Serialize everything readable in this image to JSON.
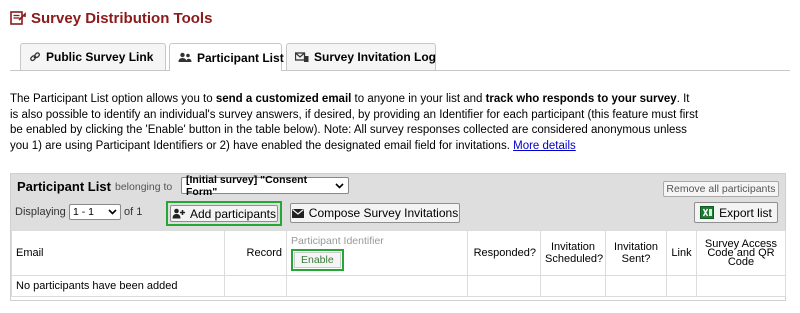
{
  "header": {
    "title": "Survey Distribution Tools",
    "icon": "survey-distribution-icon",
    "color": "#8b1a1a"
  },
  "tabs": [
    {
      "label": "Public Survey Link",
      "icon": "link-icon",
      "active": false
    },
    {
      "label": "Participant List",
      "icon": "users-icon",
      "active": true
    },
    {
      "label": "Survey Invitation Log",
      "icon": "mail-log-icon",
      "active": false
    }
  ],
  "intro": {
    "p1": "The Participant List option allows you to ",
    "b1": "send a customized email",
    "p2": " to anyone in your list and ",
    "b2": "track who responds to your survey",
    "p3": ". It is also possible to identify an individual's survey answers, if desired, by providing an Identifier for each participant (this feature must first be enabled by clicking the 'Enable' button in the table below). Note: All survey responses collected are considered anonymous unless you 1) are using Participant Identifiers or 2) have enabled the designated email field for invitations. ",
    "link": "More details"
  },
  "panel": {
    "title": "Participant List",
    "belonging": "belonging to",
    "instrument_selected": "[Initial survey] \"Consent Form\"",
    "remove_all": "Remove all participants",
    "displaying": "Displaying",
    "page_selected": "1 - 1",
    "of": "of 1",
    "add_participants": "Add participants",
    "compose": "Compose Survey Invitations",
    "export": "Export list"
  },
  "table": {
    "columns": {
      "email": "Email",
      "record": "Record",
      "participant_identifier": "Participant Identifier",
      "enable": "Enable",
      "responded": "Responded?",
      "invitation_scheduled": "Invitation Scheduled?",
      "invitation_sent": "Invitation Sent?",
      "link": "Link",
      "access_code": "Survey Access Code and QR Code"
    },
    "empty_message": "No participants have been added"
  },
  "colors": {
    "highlight": "#22a833",
    "link": "#0000cc",
    "panel_header": "#dedede"
  }
}
